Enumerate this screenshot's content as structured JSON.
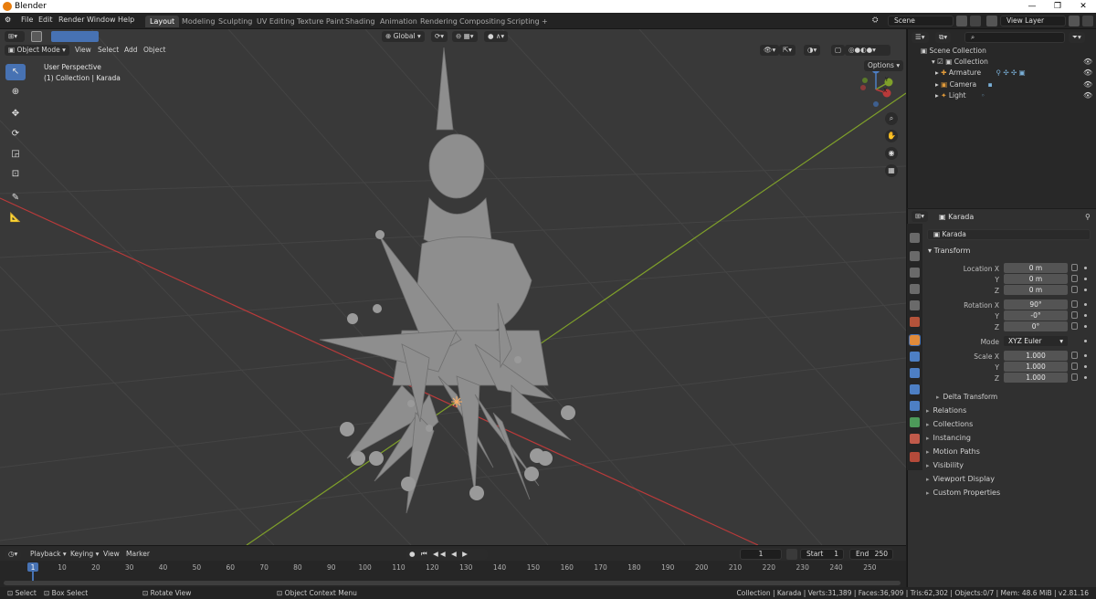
{
  "window": {
    "title": "Blender"
  },
  "menubar": {
    "items": [
      "File",
      "Edit",
      "Render",
      "Window",
      "Help"
    ],
    "workspaces": [
      "Layout",
      "Modeling",
      "Sculpting",
      "UV Editing",
      "Texture Paint",
      "Shading",
      "Animation",
      "Rendering",
      "Compositing",
      "Scripting"
    ],
    "active_workspace": "Layout",
    "add_workspace": "+",
    "scene": "Scene",
    "view_layer": "View Layer"
  },
  "viewport": {
    "mode": "Object Mode",
    "menus": [
      "View",
      "Select",
      "Add",
      "Object"
    ],
    "transform_orientation": "Global",
    "options_label": "Options",
    "overlay_title": "User Perspective",
    "overlay_subtitle": "(1) Collection | Karada",
    "gizmo": {
      "x": "X",
      "y": "Y",
      "z": "Z"
    }
  },
  "outliner": {
    "root": "Scene Collection",
    "collection": "Collection",
    "items": [
      "Armature",
      "Camera",
      "Light"
    ]
  },
  "properties": {
    "object_name": "Karada",
    "data_name": "Karada",
    "transform_header": "Transform",
    "location": {
      "label": "Location X",
      "x": "0 m",
      "y": "0 m",
      "z": "0 m"
    },
    "rotation": {
      "label": "Rotation X",
      "x": "90°",
      "y": "-0°",
      "z": "0°"
    },
    "mode_label": "Mode",
    "mode_value": "XYZ Euler",
    "scale": {
      "label": "Scale X",
      "x": "1.000",
      "y": "1.000",
      "z": "1.000"
    },
    "axis_y": "Y",
    "axis_z": "Z",
    "delta_transform": "Delta Transform",
    "sections": [
      "Relations",
      "Collections",
      "Instancing",
      "Motion Paths",
      "Visibility",
      "Viewport Display",
      "Custom Properties"
    ]
  },
  "timeline": {
    "menus": [
      "Playback",
      "Keying",
      "View",
      "Marker"
    ],
    "current_frame": "1",
    "start_label": "Start",
    "start_value": "1",
    "end_label": "End",
    "end_value": "250",
    "ticks": [
      "1",
      "10",
      "20",
      "30",
      "40",
      "50",
      "60",
      "70",
      "80",
      "90",
      "100",
      "110",
      "120",
      "130",
      "140",
      "150",
      "160",
      "170",
      "180",
      "190",
      "200",
      "210",
      "220",
      "230",
      "240",
      "250"
    ]
  },
  "statusbar": {
    "select": "Select",
    "box_select": "Box Select",
    "rotate_view": "Rotate View",
    "context_menu": "Object Context Menu",
    "stats": "Collection | Karada | Verts:31,389 | Faces:36,909 | Tris:62,302 | Objects:0/7 | Mem: 48.6 MiB | v2.81.16"
  },
  "colors": {
    "accent": "#4772b3",
    "viewport_bg": "#393939",
    "x_axis": "#b83a3a",
    "y_axis": "#7fa02a"
  }
}
